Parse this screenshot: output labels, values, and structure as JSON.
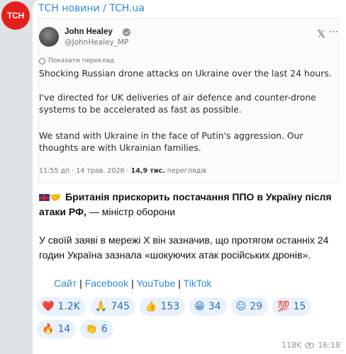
{
  "channel": {
    "avatar_text": "ТСН",
    "name": "ТСН новини / TCH.ua"
  },
  "tweet": {
    "author_name": "John Healey",
    "handle": "@JohnHealey_MP",
    "translate_label": "Показати переклад",
    "paragraphs": [
      "Shocking Russian drone attacks on Ukraine over the last 24 hours.",
      "I've directed for UK deliveries of air defence and counter-drone systems to be accelerated as fast as possible.",
      "We stand with Ukraine in the face of Putin's aggression. Our thoughts are with Ukrainian families."
    ],
    "time": "11:55 дп · 14 трав. 2026 · ",
    "views": "14,9 тис.",
    "views_label": " переглядів"
  },
  "post": {
    "headline_bold": "Британія прискорить постачання ППО в Україну після атаки РФ,",
    "headline_rest": " — міністр оборони",
    "body": "У своїй заяві в мережі Х він зазначив, що протягом останніх 24 годин Україна зазнала «шокуючих атак російських дронів».",
    "links": {
      "site": "Сайт",
      "sep": " | ",
      "facebook": "Facebook",
      "youtube": "YouTube",
      "tiktok": "TikTok"
    }
  },
  "reactions": [
    {
      "emoji": "❤️",
      "icon": "heart-icon",
      "count": "1.2K"
    },
    {
      "emoji": "🙏",
      "icon": "pray-icon",
      "count": "745"
    },
    {
      "emoji": "👍",
      "icon": "thumbs-up-icon",
      "count": "153"
    },
    {
      "emoji": "😁",
      "icon": "grin-icon",
      "count": "34"
    },
    {
      "emoji": "😐",
      "icon": "neutral-face-icon",
      "count": "29"
    },
    {
      "emoji": "💯",
      "icon": "hundred-icon",
      "count": "15"
    },
    {
      "emoji": "🔥",
      "icon": "fire-icon",
      "count": "14"
    },
    {
      "emoji": "👏",
      "icon": "clap-icon",
      "count": "6"
    }
  ],
  "footer": {
    "views": "118K",
    "time": "16:18"
  },
  "colors": {
    "accent": "#2a8be0",
    "brand_red": "#e3201d",
    "chip_bg": "#e9f1fb"
  }
}
